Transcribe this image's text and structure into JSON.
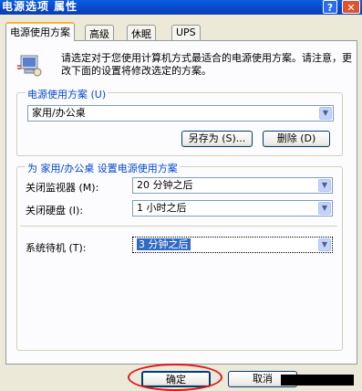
{
  "window": {
    "title": "电源选项 属性",
    "help": "?",
    "close": "✕"
  },
  "tabs": [
    {
      "label": "电源使用方案"
    },
    {
      "label": "高级"
    },
    {
      "label": "休眠"
    },
    {
      "label": "UPS"
    }
  ],
  "description": "请选定对于您使用计算机方式最适合的电源使用方案。请注意，更改下面的设置将修改选定的方案。",
  "scheme_group": {
    "label": "电源使用方案 (U)",
    "selected": "家用/办公桌",
    "save_as_button": "另存为 (S)...",
    "delete_button": "删除 (D)"
  },
  "settings_group": {
    "label": "为 家用/办公桌 设置电源使用方案",
    "monitor_label": "关闭监视器 (M):",
    "monitor_value": "20 分钟之后",
    "harddisk_label": "关闭硬盘 (I):",
    "harddisk_value": "1 小时之后",
    "standby_label": "系统待机 (T):",
    "standby_value": "3 分钟之后"
  },
  "footer": {
    "ok": "确定",
    "cancel": "取消"
  }
}
